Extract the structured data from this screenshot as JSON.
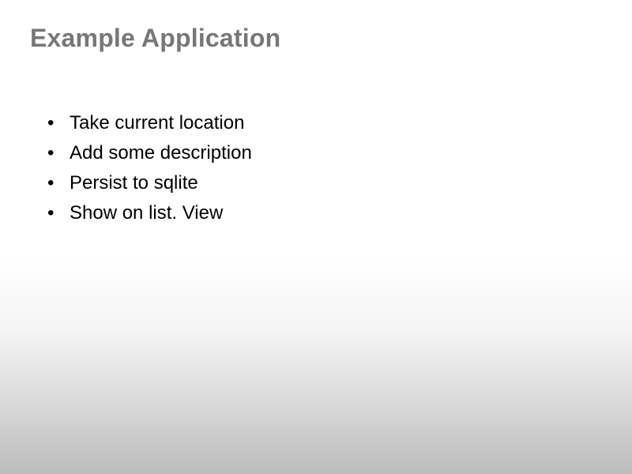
{
  "slide": {
    "title": "Example Application",
    "bullets": [
      "Take current location",
      "Add some description",
      "Persist to sqlite",
      "Show on list. View"
    ]
  }
}
